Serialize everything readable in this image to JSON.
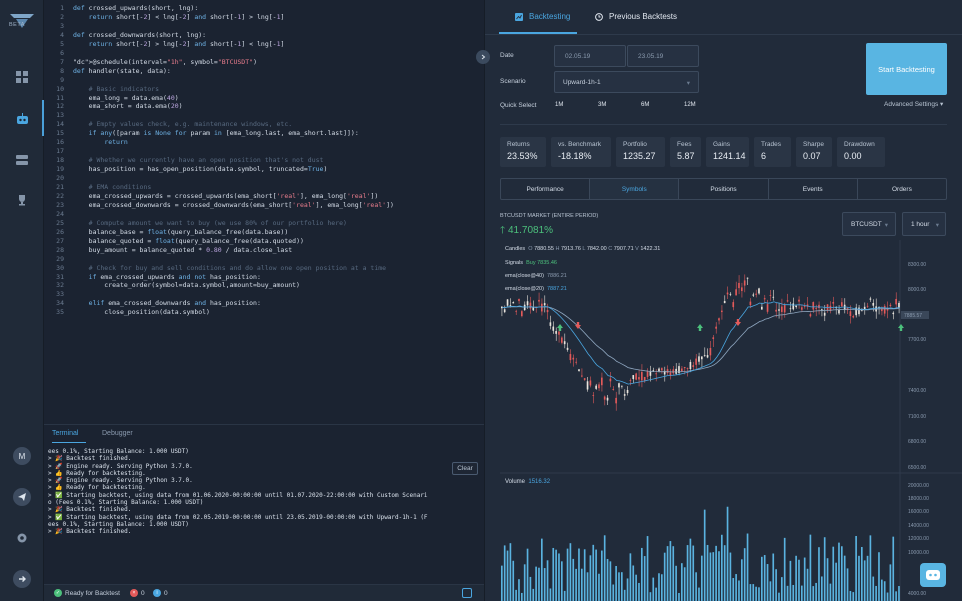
{
  "app": {
    "badge": "BETA"
  },
  "editor": {
    "lines": [
      {
        "n": "1",
        "t": "def crossed_upwards(short, lng):"
      },
      {
        "n": "2",
        "t": "    return short[-2] < lng[-2] and short[-1] > lng[-1]"
      },
      {
        "n": "3",
        "t": ""
      },
      {
        "n": "4",
        "t": "def crossed_downwards(short, lng):"
      },
      {
        "n": "5",
        "t": "    return short[-2] > lng[-2] and short[-1] < lng[-1]"
      },
      {
        "n": "6",
        "t": ""
      },
      {
        "n": "7",
        "t": "@schedule(interval=\"1h\", symbol=\"BTCUSDT\")"
      },
      {
        "n": "8",
        "t": "def handler(state, data):"
      },
      {
        "n": "9",
        "t": ""
      },
      {
        "n": "10",
        "t": "    # Basic indicators"
      },
      {
        "n": "11",
        "t": "    ema_long = data.ema(40)"
      },
      {
        "n": "12",
        "t": "    ema_short = data.ema(20)"
      },
      {
        "n": "13",
        "t": ""
      },
      {
        "n": "14",
        "t": "    # Empty values check, e.g. maintenance windows, etc."
      },
      {
        "n": "15",
        "t": "    if any([param is None for param in [ema_long.last, ema_short.last]]):"
      },
      {
        "n": "16",
        "t": "        return"
      },
      {
        "n": "17",
        "t": ""
      },
      {
        "n": "18",
        "t": "    # Whether we currently have an open position that's not dust"
      },
      {
        "n": "19",
        "t": "    has_position = has_open_position(data.symbol, truncated=True)"
      },
      {
        "n": "20",
        "t": ""
      },
      {
        "n": "21",
        "t": "    # EMA conditions"
      },
      {
        "n": "22",
        "t": "    ema_crossed_upwards = crossed_upwards(ema_short['real'], ema_long['real'])"
      },
      {
        "n": "23",
        "t": "    ema_crossed_downwards = crossed_downwards(ema_short['real'], ema_long['real'])"
      },
      {
        "n": "24",
        "t": ""
      },
      {
        "n": "25",
        "t": "    # Compute amount we want to buy (we use 80% of our portfolio here)"
      },
      {
        "n": "26",
        "t": "    balance_base = float(query_balance_free(data.base))"
      },
      {
        "n": "27",
        "t": "    balance_quoted = float(query_balance_free(data.quoted))"
      },
      {
        "n": "28",
        "t": "    buy_amount = balance_quoted * 0.80 / data.close_last"
      },
      {
        "n": "29",
        "t": ""
      },
      {
        "n": "30",
        "t": "    # Check for buy and sell conditions and do allow one open position at a time"
      },
      {
        "n": "31",
        "t": "    if ema_crossed_upwards and not has_position:"
      },
      {
        "n": "32",
        "t": "        create_order(symbol=data.symbol,amount=buy_amount)"
      },
      {
        "n": "33",
        "t": ""
      },
      {
        "n": "34",
        "t": "    elif ema_crossed_downwards and has_position:"
      },
      {
        "n": "35",
        "t": "        close_position(data.symbol)"
      }
    ]
  },
  "terminal": {
    "tabs": [
      "Terminal",
      "Debugger"
    ],
    "clear_label": "Clear",
    "lines": [
      "ees 0.1%, Starting Balance: 1.000 USDT)",
      "> 🎉 Backtest finished.",
      "> 🚀 Engine ready. Serving Python 3.7.0.",
      "> 👍 Ready for backtesting.",
      "> 🚀 Engine ready. Serving Python 3.7.0.",
      "> 👍 Ready for backtesting.",
      "> ✅ Starting backtest, using data from 01.06.2020-00:00:00 until 01.07.2020-22:00:00 with Custom Scenari",
      "o (Fees 0.1%, Starting Balance: 1.000 USDT)",
      "> 🎉 Backtest finished.",
      "> ✅ Starting backtest, using data from 02.05.2019-00:00:00 until 23.05.2019-00:00:00 with Upward-1h-1 (F",
      "ees 0.1%, Starting Balance: 1.000 USDT)",
      "> 🎉 Backtest finished."
    ]
  },
  "statusbar": {
    "ready": "Ready for Backtest",
    "errors": "0",
    "infos": "0"
  },
  "sidebar": {
    "avatar_letter": "M"
  },
  "right": {
    "tabs": {
      "backtesting": "Backtesting",
      "previous": "Previous Backtests"
    },
    "date_label": "Date",
    "date_from": "02.05.19",
    "date_to": "23.05.19",
    "scenario_label": "Scenario",
    "scenario_value": "Upward-1h-1",
    "quick_label": "Quick Select",
    "quick": [
      "1M",
      "3M",
      "6M",
      "12M"
    ],
    "start_label": "Start Backtesting",
    "advanced_label": "Advanced Settings",
    "metrics": [
      {
        "label": "Returns",
        "value": "23.53%"
      },
      {
        "label": "vs. Benchmark",
        "value": "-18.18%"
      },
      {
        "label": "Portfolio",
        "value": "1235.27"
      },
      {
        "label": "Fees",
        "value": "5.87"
      },
      {
        "label": "Gains",
        "value": "1241.14"
      },
      {
        "label": "Trades",
        "value": "6"
      },
      {
        "label": "Sharpe",
        "value": "0.07"
      },
      {
        "label": "Drawdown",
        "value": "0.00"
      }
    ],
    "subtabs": [
      "Performance",
      "Symbols",
      "Positions",
      "Events",
      "Orders"
    ],
    "market_label": "BTCUSDT MARKET (ENTIRE PERIOD)",
    "market_pct": "41.7081%",
    "symbol_select": "BTCUSDT",
    "interval_select": "1 hour",
    "legend": {
      "candles": "Candles",
      "o": "O",
      "o_v": "7880.55",
      "h": "H",
      "h_v": "7913.76",
      "l": "L",
      "l_v": "7842.00",
      "c": "C",
      "c_v": "7907.71",
      "v": "V",
      "v_v": "1422.31",
      "signals": "Signals",
      "signals_v": "Buy 7835.46",
      "ema40": "ema(close@40)",
      "ema40_v": "7886.21",
      "ema20": "ema(close@20)",
      "ema20_v": "7887.21"
    },
    "volume_label": "Volume",
    "volume_v": "1516.32",
    "price_ticks": [
      "8300.00",
      "8000.00",
      "7700.00",
      "7400.00",
      "7100.00",
      "6800.00",
      "6500.00"
    ],
    "last_price": "7885.57",
    "vol_ticks": [
      "20000.00",
      "18000.00",
      "16000.00",
      "14000.00",
      "12000.00",
      "10000.00",
      "4000.00"
    ]
  },
  "colors": {
    "accent": "#4aa6e0",
    "up": "#4cc07c",
    "down": "#e35a5a",
    "bg": "#1c2431"
  }
}
